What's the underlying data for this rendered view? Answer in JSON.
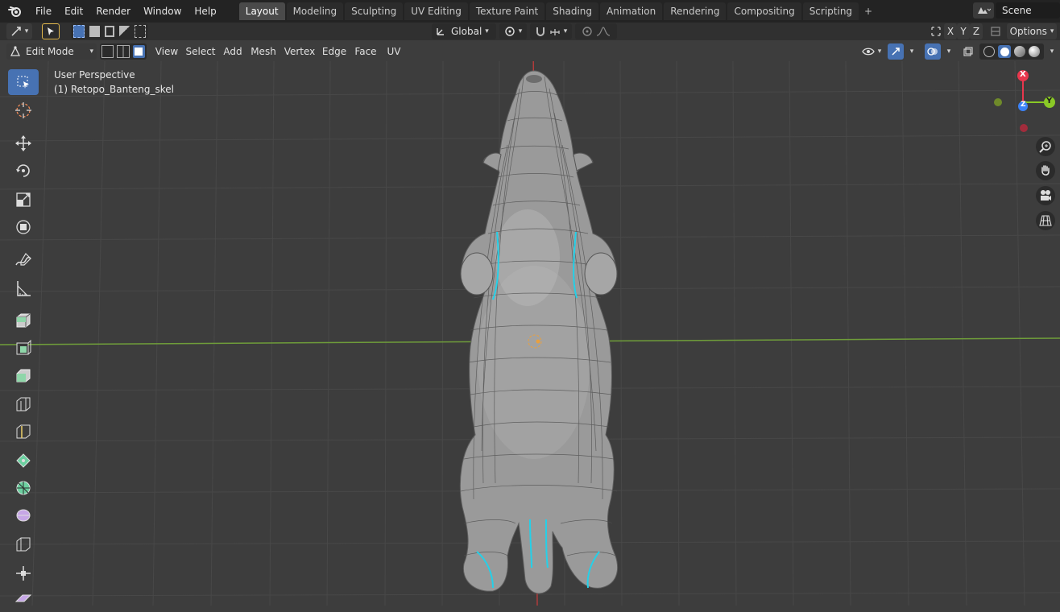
{
  "topbar": {
    "menus": [
      "File",
      "Edit",
      "Render",
      "Window",
      "Help"
    ],
    "workspaces": [
      "Layout",
      "Modeling",
      "Sculpting",
      "UV Editing",
      "Texture Paint",
      "Shading",
      "Animation",
      "Rendering",
      "Compositing",
      "Scripting"
    ],
    "active_workspace": "Layout",
    "add_tab": "+",
    "scene": "Scene"
  },
  "header": {
    "transform_orientation": "Global",
    "axes": [
      "X",
      "Y",
      "Z"
    ],
    "options": "Options"
  },
  "modebar": {
    "mode": "Edit Mode",
    "menus": [
      "View",
      "Select",
      "Add",
      "Mesh",
      "Vertex",
      "Edge",
      "Face",
      "UV"
    ]
  },
  "viewport": {
    "perspective": "User Perspective",
    "object": "(1) Retopo_Banteng_skel"
  },
  "gizmo": {
    "x": "X",
    "y": "Y",
    "z": "Z"
  },
  "colors": {
    "accent": "#4772b3",
    "x_axis": "#e8374d",
    "y_axis": "#8ac926",
    "z_axis": "#3b82f6",
    "selection_edge": "#25d0e8",
    "grid_green": "#6f9d3a",
    "grid_red": "#c23b3b"
  }
}
